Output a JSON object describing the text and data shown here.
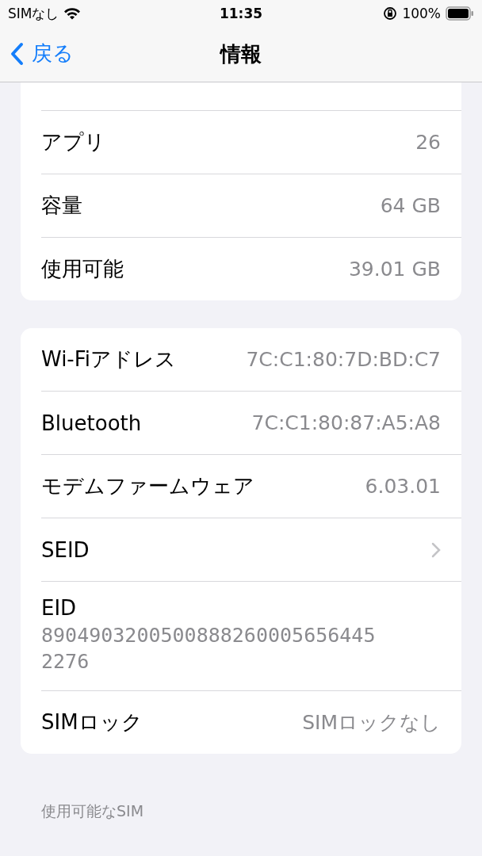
{
  "status_bar": {
    "carrier": "SIMなし",
    "time": "11:35",
    "battery": "100%"
  },
  "nav": {
    "back": "戻る",
    "title": "情報"
  },
  "groups": [
    {
      "partial_top": true,
      "rows": [
        {
          "kind": "value",
          "label": "アプリ",
          "value": "26"
        },
        {
          "kind": "value",
          "label": "容量",
          "value": "64 GB"
        },
        {
          "kind": "value",
          "label": "使用可能",
          "value": "39.01 GB"
        }
      ]
    },
    {
      "partial_top": false,
      "rows": [
        {
          "kind": "value",
          "label": "Wi-Fiアドレス",
          "value": "7C:C1:80:7D:BD:C7"
        },
        {
          "kind": "value",
          "label": "Bluetooth",
          "value": "7C:C1:80:87:A5:A8"
        },
        {
          "kind": "value",
          "label": "モデムファームウェア",
          "value": "6.03.01"
        },
        {
          "kind": "chevron",
          "label": "SEID"
        },
        {
          "kind": "stacked",
          "label": "EID",
          "value": "89049032005008882600056564452276"
        },
        {
          "kind": "value",
          "label": "SIMロック",
          "value": "SIMロックなし"
        }
      ]
    }
  ],
  "section_header": "使用可能なSIM"
}
